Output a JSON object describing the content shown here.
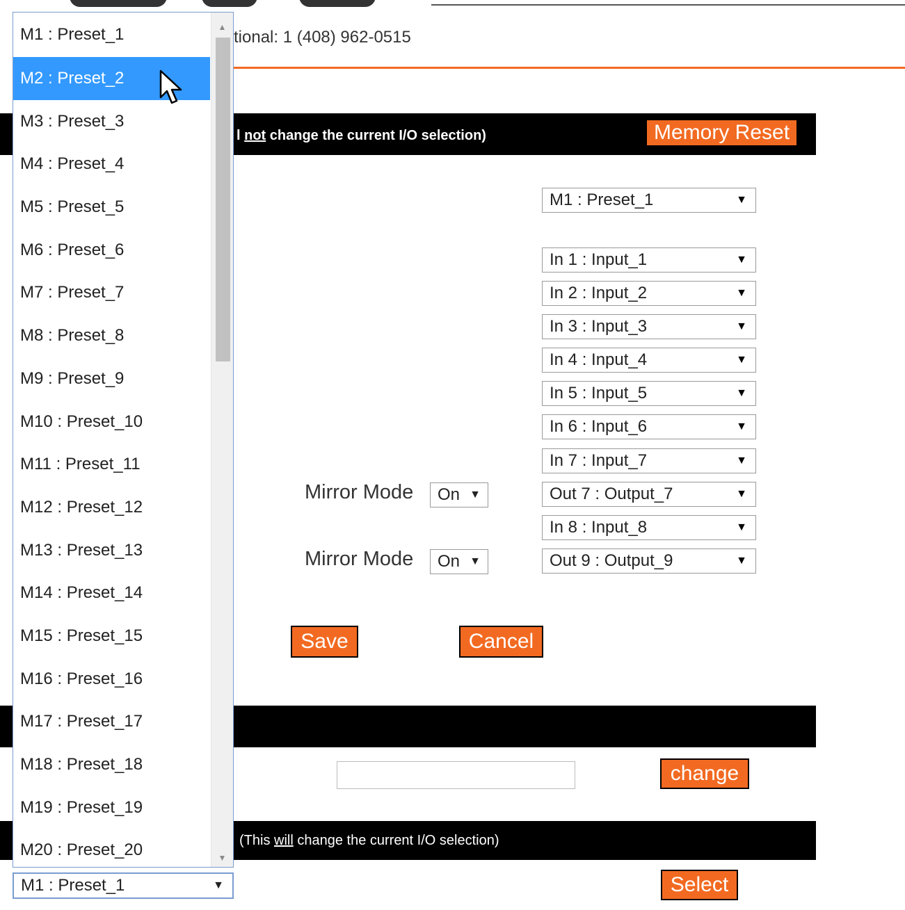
{
  "header": {
    "contact_text": "tional: 1 (408) 962-0515"
  },
  "memory_bar": {
    "note_pre": "l ",
    "note_under": "not",
    "note_post": " change the current I/O selection)",
    "reset_label": "Memory Reset"
  },
  "memory_select": {
    "value": "M1 : Preset_1"
  },
  "io_selects": [
    "In 1 : Input_1",
    "In 2 : Input_2",
    "In 3 : Input_3",
    "In 4 : Input_4",
    "In 5 : Input_5",
    "In 6 : Input_6",
    "In 7 : Input_7",
    "Out 7 : Output_7",
    "In 8 : Input_8",
    "Out 9 : Output_9"
  ],
  "mirror": [
    {
      "label": "Mirror Mode",
      "value": "On"
    },
    {
      "label": "Mirror Mode",
      "value": "On"
    }
  ],
  "actions": {
    "save": "Save",
    "cancel": "Cancel",
    "change": "change",
    "select": "Select"
  },
  "select_bar": {
    "note_pre": "(This ",
    "note_under": "will",
    "note_post": " change the current I/O selection)"
  },
  "dropdown": {
    "highlighted_index": 1,
    "options": [
      "M1 : Preset_1",
      "M2 : Preset_2",
      "M3 : Preset_3",
      "M4 : Preset_4",
      "M5 : Preset_5",
      "M6 : Preset_6",
      "M7 : Preset_7",
      "M8 : Preset_8",
      "M9 : Preset_9",
      "M10 : Preset_10",
      "M11 : Preset_11",
      "M12 : Preset_12",
      "M13 : Preset_13",
      "M14 : Preset_14",
      "M15 : Preset_15",
      "M16 : Preset_16",
      "M17 : Preset_17",
      "M18 : Preset_18",
      "M19 : Preset_19",
      "M20 : Preset_20"
    ],
    "selected_value": "M1 : Preset_1"
  },
  "colors": {
    "accent": "#f26a21",
    "highlight": "#3399ff",
    "bar": "#000000"
  },
  "icons": {
    "dropdown_arrow": "▼",
    "scroll_up": "▲",
    "scroll_down": "▼"
  }
}
